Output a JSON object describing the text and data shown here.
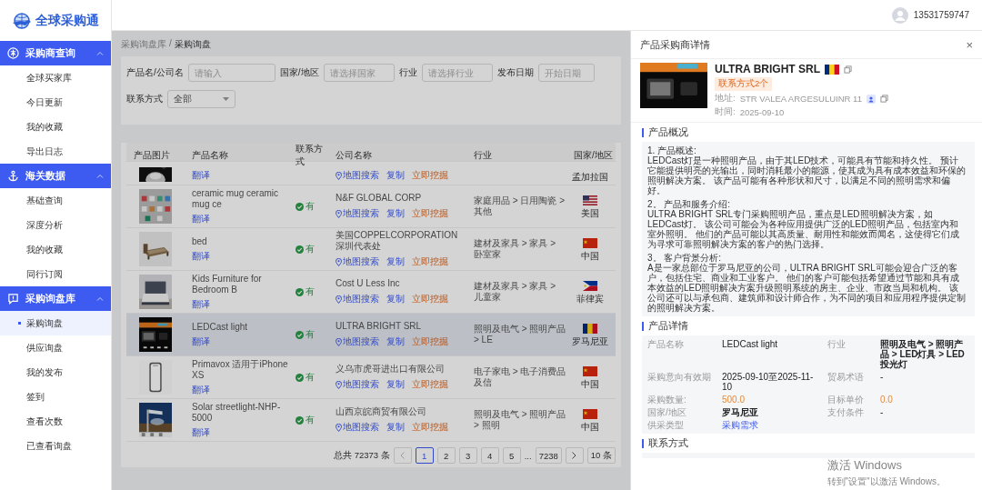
{
  "logo": {
    "text": "全球采购通"
  },
  "header": {
    "user_phone": "13531759747"
  },
  "sidebar": {
    "groups": [
      {
        "label": "采购商查询",
        "kind": "circle",
        "expanded": true,
        "items": [
          {
            "label": "全球买家库",
            "selected": false
          },
          {
            "label": "今日更新",
            "selected": false
          },
          {
            "label": "我的收藏",
            "selected": false
          },
          {
            "label": "导出日志",
            "selected": false
          }
        ]
      },
      {
        "label": "海关数据",
        "kind": "anchor",
        "expanded": true,
        "items": [
          {
            "label": "基础查询",
            "selected": false
          },
          {
            "label": "深度分析",
            "selected": false
          },
          {
            "label": "我的收藏",
            "selected": false
          },
          {
            "label": "同行订阅",
            "selected": false
          }
        ]
      },
      {
        "label": "采购询盘库",
        "kind": "bubble",
        "expanded": true,
        "items": [
          {
            "label": "采购询盘",
            "selected": true
          },
          {
            "label": "供应询盘",
            "selected": false
          },
          {
            "label": "我的发布",
            "selected": false
          },
          {
            "label": "签到",
            "selected": false
          },
          {
            "label": "查看次数",
            "selected": false
          },
          {
            "label": "已查看询盘",
            "selected": false
          }
        ]
      }
    ]
  },
  "breadcrumb": {
    "parent": "采购询盘库",
    "separator": "/",
    "current": "采购询盘"
  },
  "filters": [
    {
      "label": "产品名/公司名",
      "placeholder": "请输入",
      "kind": "text"
    },
    {
      "label": "国家/地区",
      "placeholder": "请选择国家",
      "kind": "text"
    },
    {
      "label": "行业",
      "placeholder": "请选择行业",
      "kind": "text"
    },
    {
      "label": "发布日期",
      "placeholder": "开始日期",
      "kind": "text"
    },
    {
      "label": "联系方式",
      "value": "全部",
      "kind": "select"
    }
  ],
  "table": {
    "columns": [
      "产品图片",
      "产品名称",
      "联系方式",
      "公司名称",
      "行业",
      "国家/地区"
    ],
    "rows": [
      {
        "kind": "partial",
        "selected": false,
        "translate": "翻译",
        "actions": [
          {
            "label": "地图搜索",
            "kind": "map"
          },
          {
            "label": "复制",
            "kind": "copy"
          },
          {
            "label": "立即挖掘",
            "kind": "dig"
          }
        ],
        "country": "孟加拉国"
      },
      {
        "kind": "full",
        "selected": false,
        "name": "ceramic mug ceramic mug ce",
        "translate": "翻译",
        "contact": "有",
        "company": "N&F GLOBAL CORP",
        "actions": [
          {
            "label": "地图搜索",
            "kind": "map"
          },
          {
            "label": "复制",
            "kind": "copy"
          },
          {
            "label": "立即挖掘",
            "kind": "dig"
          }
        ],
        "industry": "家庭用品 > 日用陶瓷 > 其他",
        "flag": {
          "kind": "us"
        },
        "country": "美国"
      },
      {
        "kind": "full",
        "selected": false,
        "name": "bed",
        "translate": "翻译",
        "contact": "有",
        "company": "美国COPPELCORPORATION深圳代表处",
        "actions": [
          {
            "label": "地图搜索",
            "kind": "map"
          },
          {
            "label": "复制",
            "kind": "copy"
          },
          {
            "label": "立即挖掘",
            "kind": "dig"
          }
        ],
        "industry": "建材及家具 > 家具 > 卧室家",
        "flag": {
          "kind": "cn"
        },
        "country": "中国"
      },
      {
        "kind": "full",
        "selected": false,
        "name": "Kids Furniture for Bedroom B",
        "translate": "翻译",
        "contact": "有",
        "company": "Cost U Less Inc",
        "actions": [
          {
            "label": "地图搜索",
            "kind": "map"
          },
          {
            "label": "复制",
            "kind": "copy"
          },
          {
            "label": "立即挖掘",
            "kind": "dig"
          }
        ],
        "industry": "建材及家具 > 家具 > 儿童家",
        "flag": {
          "kind": "ph"
        },
        "country": "菲律宾"
      },
      {
        "kind": "full",
        "selected": true,
        "name": "LEDCast light",
        "translate": "翻译",
        "contact": "有",
        "company": "ULTRA BRIGHT SRL",
        "actions": [
          {
            "label": "地图搜索",
            "kind": "map"
          },
          {
            "label": "复制",
            "kind": "copy"
          },
          {
            "label": "立即挖掘",
            "kind": "dig"
          }
        ],
        "industry": "照明及电气 > 照明产品 > LE",
        "flag": {
          "kind": "ro"
        },
        "country": "罗马尼亚"
      },
      {
        "kind": "full",
        "selected": false,
        "name": "Primavox 适用于iPhone XS",
        "translate": "翻译",
        "contact": "有",
        "company": "义乌市虎哥进出口有限公司",
        "actions": [
          {
            "label": "地图搜索",
            "kind": "map"
          },
          {
            "label": "复制",
            "kind": "copy"
          },
          {
            "label": "立即挖掘",
            "kind": "dig"
          }
        ],
        "industry": "电子家电 > 电子消费品及信",
        "flag": {
          "kind": "cn"
        },
        "country": "中国"
      },
      {
        "kind": "full",
        "selected": false,
        "name": "Solar streetlight-NHP-5000",
        "translate": "翻译",
        "contact": "有",
        "company": "山西京皖商贸有限公司",
        "actions": [
          {
            "label": "地图搜索",
            "kind": "map"
          },
          {
            "label": "复制",
            "kind": "copy"
          },
          {
            "label": "立即挖掘",
            "kind": "dig"
          }
        ],
        "industry": "照明及电气 > 照明产品 > 照明",
        "flag": {
          "kind": "cn"
        },
        "country": "中国"
      }
    ]
  },
  "pagination": {
    "total": "总共 72373 条",
    "pages": [
      {
        "label": "1",
        "selected": true
      },
      {
        "label": "2",
        "selected": false
      },
      {
        "label": "3",
        "selected": false
      },
      {
        "label": "4",
        "selected": false
      },
      {
        "label": "5",
        "selected": false
      },
      {
        "label": "7238",
        "selected": false
      }
    ],
    "ellipsis": "...",
    "page_size": "10 条"
  },
  "drawer": {
    "title": "产品采购商详情",
    "close": "×",
    "company": {
      "name": "ULTRA BRIGHT SRL",
      "flag": {
        "kind": "ro"
      },
      "tag": "联系方式2个",
      "address_label": "地址:",
      "address": "STR VALEA ARGESULUINR 11",
      "time_label": "时间:",
      "time": "2025-09-10"
    },
    "overview": {
      "heading": "产品概况",
      "paragraphs": [
        {
          "heading": "1. 产品概述:",
          "body": "LEDCast灯是一种照明产品，由于其LED技术，可能具有节能和持久性。 预计它能提供明亮的光输出，同时消耗最小的能源，使其成为具有成本效益和环保的照明解决方案。 该产品可能有各种形状和尺寸，以满足不同的照明需求和偏好。"
        },
        {
          "heading": "2。 产品和服务介绍:",
          "body": "ULTRA BRIGHT SRL专门采购照明产品，重点是LED照明解决方案，如LEDCast灯。 该公司可能会为各种应用提供广泛的LED照明产品，包括室内和室外照明。 他们的产品可能以其高质量、耐用性和能效而闻名，这使得它们成为寻求可靠照明解决方案的客户的热门选择。"
        },
        {
          "heading": "3。 客户背景分析:",
          "body": "A是一家总部位于罗马尼亚的公司，ULTRA BRIGHT SRL可能会迎合广泛的客户，包括住宅、商业和工业客户。 他们的客户可能包括希望通过节能和具有成本效益的LED照明解决方案升级照明系统的房主、企业、市政当局和机构。 该公司还可以与承包商、建筑师和设计师合作，为不同的项目和应用程序提供定制的照明解决方案。"
        }
      ]
    },
    "details": {
      "heading": "产品详情",
      "fields": [
        {
          "label": "产品名称",
          "value": "LEDCast light",
          "kind": "plain"
        },
        {
          "label": "行业",
          "value": "照明及电气 > 照明产品 > LED灯具 > LED投光灯",
          "kind": "bold"
        },
        {
          "label": "采购意向有效期",
          "value": "2025-09-10至2025-11-10",
          "kind": "plain"
        },
        {
          "label": "贸易术语",
          "value": "-",
          "kind": "plain"
        },
        {
          "label": "采购数量:",
          "value": "500.0",
          "kind": "number"
        },
        {
          "label": "目标单价",
          "value": "0.0",
          "kind": "number"
        },
        {
          "label": "国家/地区",
          "value": "罗马尼亚",
          "kind": "bold"
        },
        {
          "label": "支付条件",
          "value": "-",
          "kind": "plain"
        },
        {
          "label": "供采类型",
          "value": "采购需求",
          "kind": "link"
        }
      ]
    },
    "contacts": {
      "heading": "联系方式"
    }
  },
  "os_notice": {
    "title": "激活 Windows",
    "subtitle": "转到\"设置\"以激活 Windows。"
  }
}
